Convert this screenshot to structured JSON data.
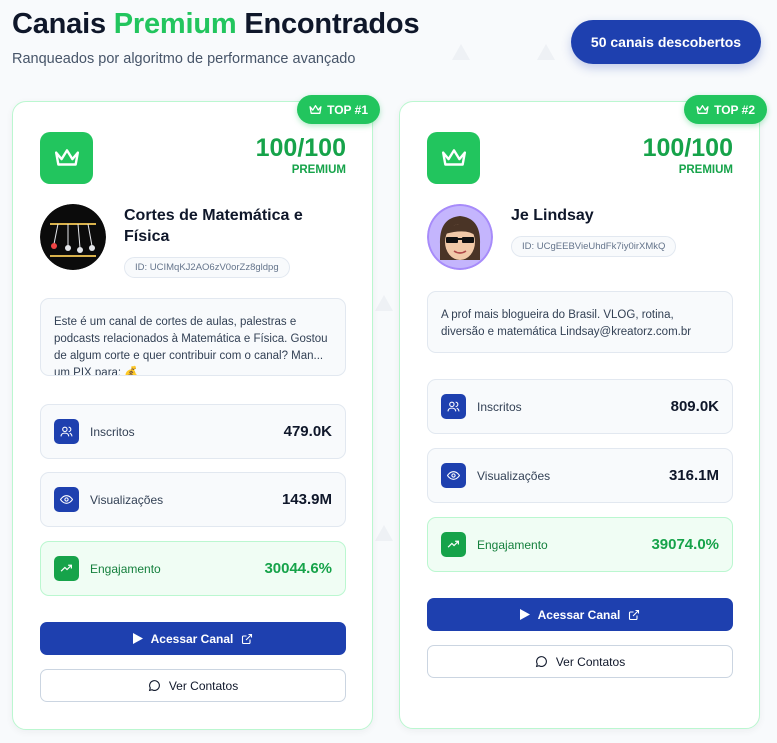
{
  "header": {
    "title_part1": "Canais",
    "title_accent": "Premium",
    "title_part2": "Encontrados",
    "subtitle": "Ranqueados por algoritmo de performance avançado",
    "count_badge": "50 canais descobertos"
  },
  "colors": {
    "accent_green": "#22c55e",
    "primary_blue": "#1e40af"
  },
  "channels": [
    {
      "rank_label": "TOP #1",
      "score": "100/100",
      "score_label": "PREMIUM",
      "name": "Cortes de Matemática e Física",
      "id": "ID: UCIMqKJ2AO6zV0orZz8gldpg",
      "description": "Este é um canal de cortes de aulas, palestras e podcasts relacionados à Matemática e Física. Gostou de algum corte e quer contribuir com o canal? Man... um PIX para: 💰",
      "stats": [
        {
          "label": "Inscritos",
          "value": "479.0K",
          "icon": "users-icon"
        },
        {
          "label": "Visualizações",
          "value": "143.9M",
          "icon": "eye-icon"
        },
        {
          "label": "Engajamento",
          "value": "30044.6%",
          "icon": "trending-up-icon"
        }
      ],
      "primary_button": "Acessar Canal",
      "secondary_button": "Ver Contatos"
    },
    {
      "rank_label": "TOP #2",
      "score": "100/100",
      "score_label": "PREMIUM",
      "name": "Je Lindsay",
      "id": "ID: UCgEEBVieUhdFk7iy0irXMkQ",
      "description": "A prof mais blogueira do Brasil. VLOG, rotina, diversão e matemática Lindsay@kreatorz.com.br",
      "stats": [
        {
          "label": "Inscritos",
          "value": "809.0K",
          "icon": "users-icon"
        },
        {
          "label": "Visualizações",
          "value": "316.1M",
          "icon": "eye-icon"
        },
        {
          "label": "Engajamento",
          "value": "39074.0%",
          "icon": "trending-up-icon"
        }
      ],
      "primary_button": "Acessar Canal",
      "secondary_button": "Ver Contatos"
    }
  ]
}
